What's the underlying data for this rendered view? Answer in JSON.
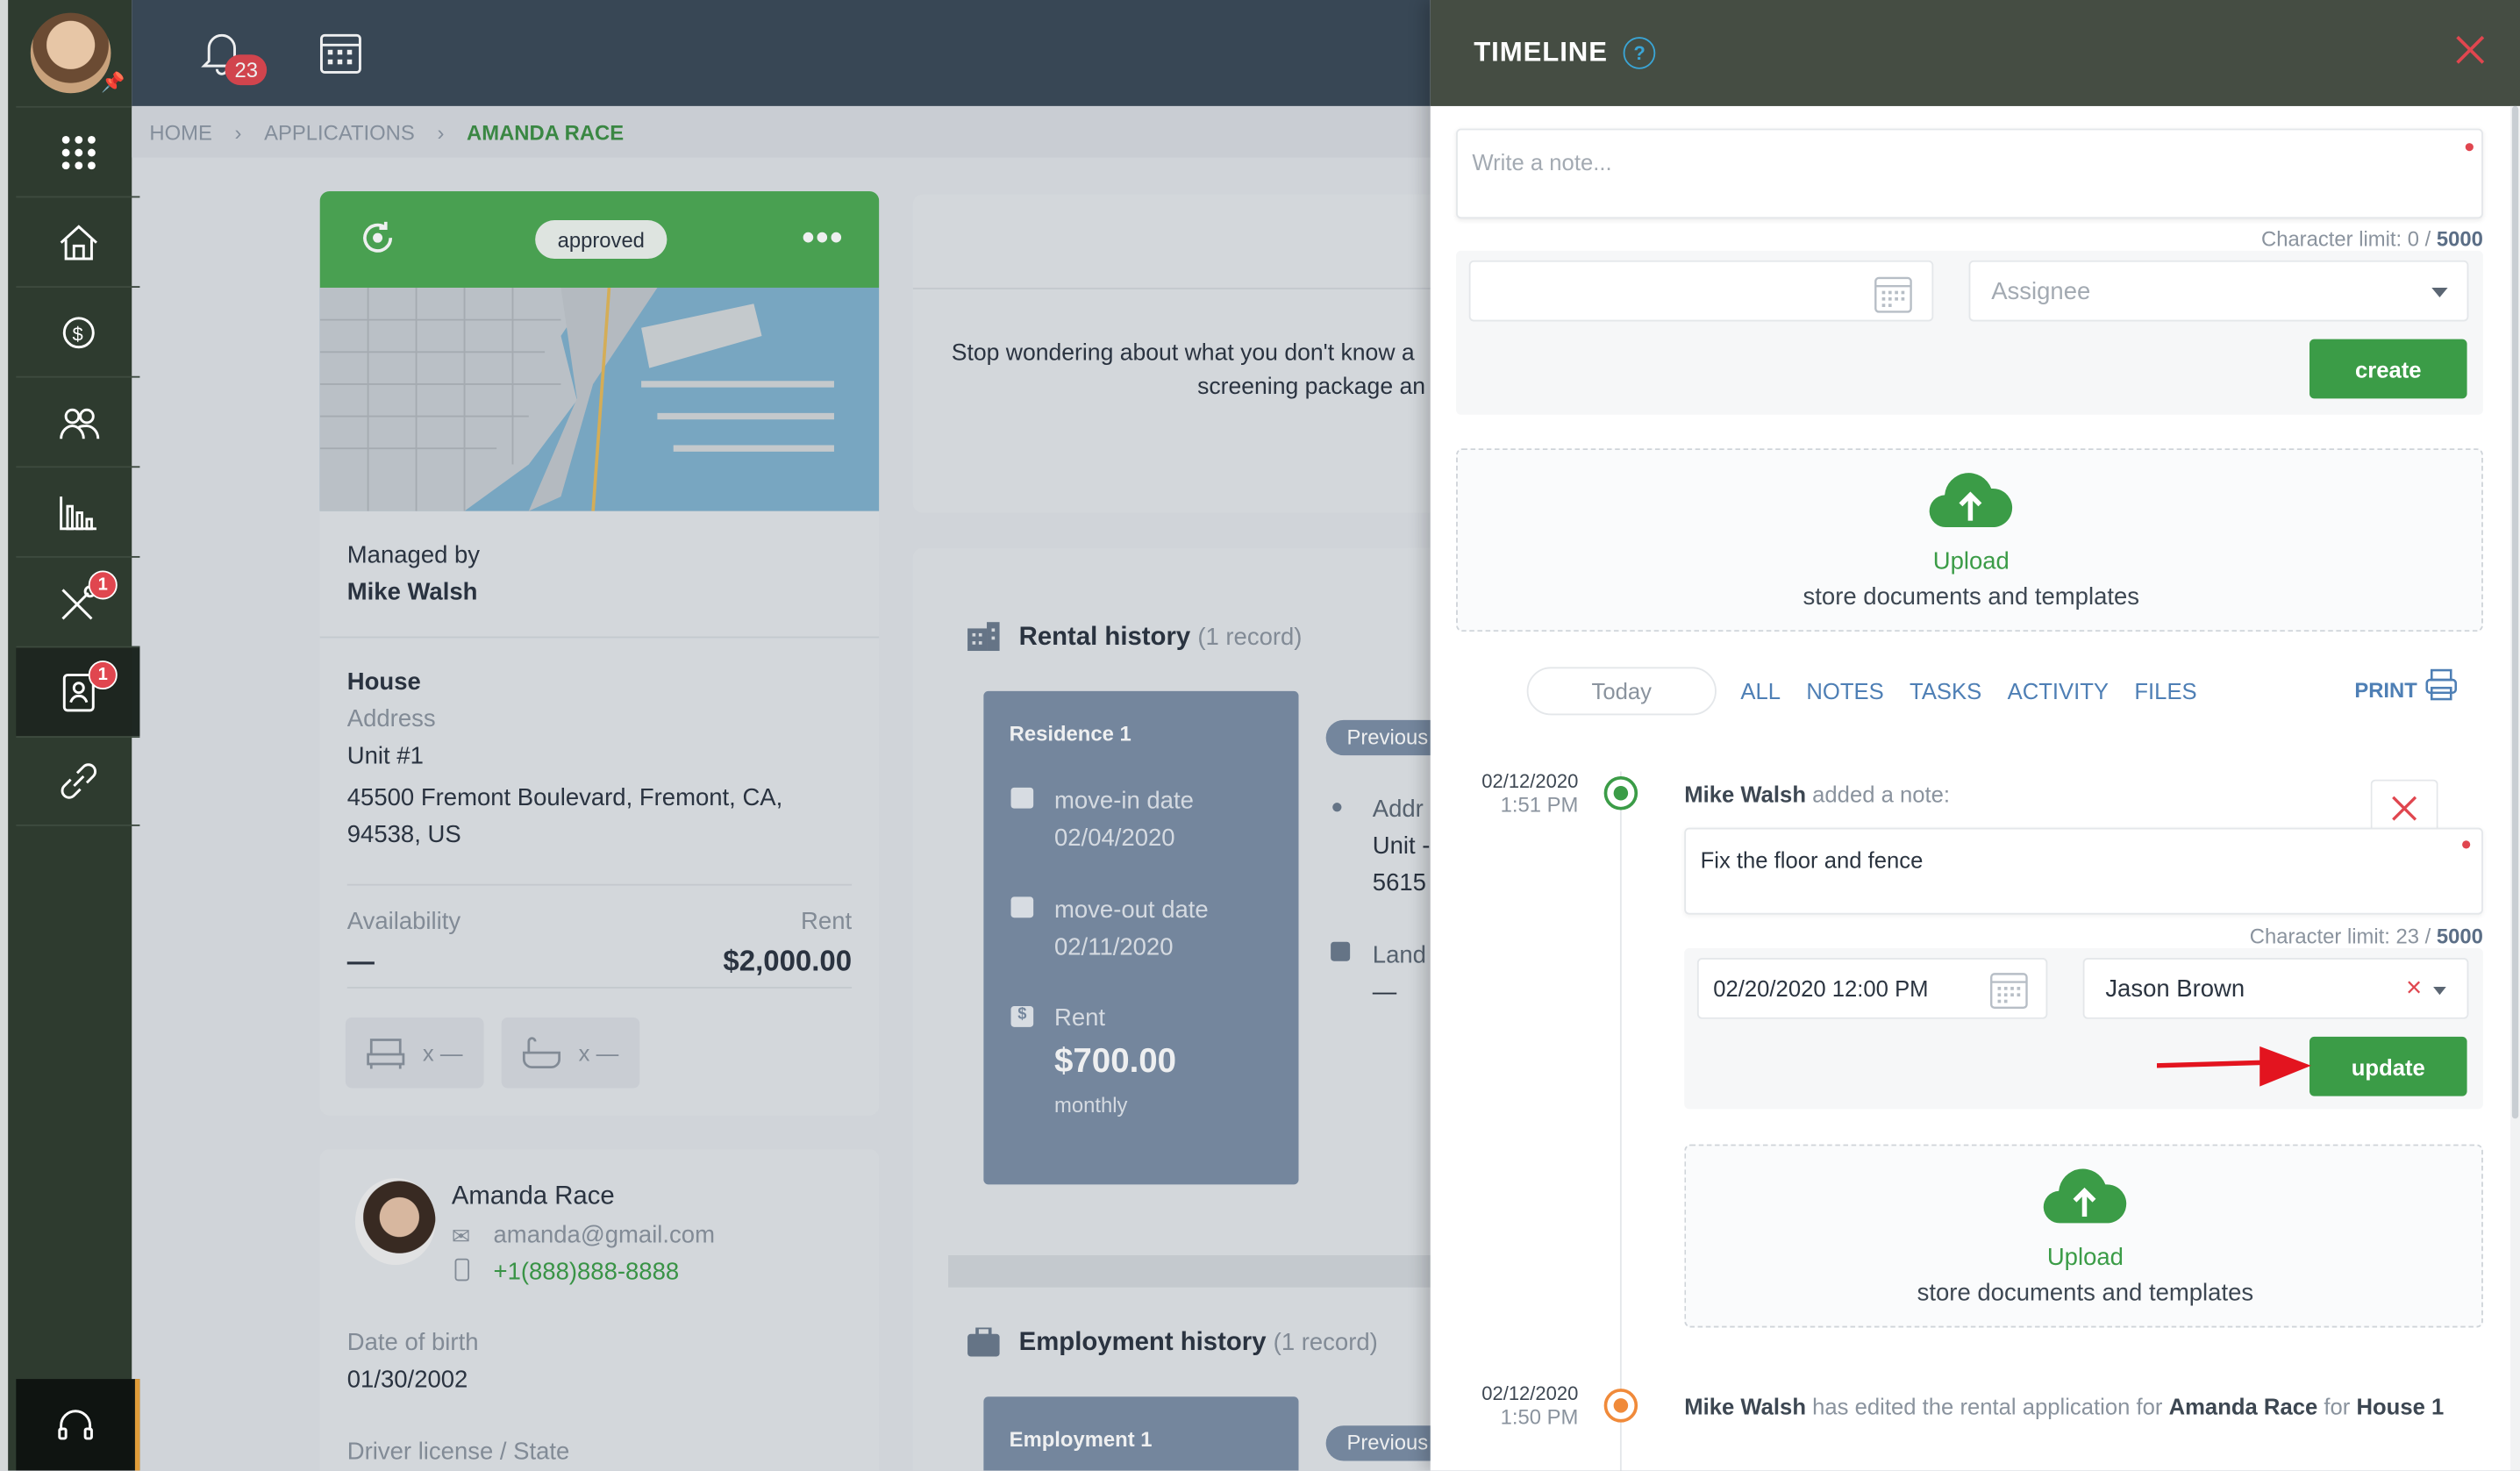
{
  "topbar": {
    "notification_count": "23"
  },
  "sidebar": {
    "badges": {
      "maintenance": "1",
      "applications": "1"
    }
  },
  "breadcrumb": {
    "home": "HOME",
    "applications": "APPLICATIONS",
    "current": "AMANDA RACE"
  },
  "property": {
    "status": "approved",
    "managed_by_label": "Managed by",
    "manager": "Mike Walsh",
    "type": "House",
    "address_label": "Address",
    "unit": "Unit #1",
    "address": "45500 Fremont Boulevard, Fremont, CA, 94538, US",
    "availability_label": "Availability",
    "availability_value": "—",
    "rent_label": "Rent",
    "rent_value": "$2,000.00",
    "beds": "x —",
    "baths": "x —"
  },
  "applicant": {
    "name": "Amanda Race",
    "email": "amanda@gmail.com",
    "phone": "+1(888)888-8888",
    "dob_label": "Date of birth",
    "dob": "01/30/2002",
    "license_label": "Driver license / State"
  },
  "screening": {
    "text_line1": "Stop wondering about what you don't know a",
    "text_line2": "screening package an"
  },
  "rental_history": {
    "title": "Rental history",
    "count": "(1 record)",
    "residence_title": "Residence 1",
    "movein_label": "move-in date",
    "movein": "02/04/2020",
    "moveout_label": "move-out date",
    "moveout": "02/11/2020",
    "rent_label": "Rent",
    "rent": "$700.00",
    "rent_period": "monthly",
    "previous_badge": "Previous",
    "addr_label": "Addr",
    "unit_partial": "Unit -",
    "num_partial": "5615",
    "land_label": "Land",
    "land_value": "—"
  },
  "employment_history": {
    "title": "Employment history",
    "count": "(1 record)",
    "item_title": "Employment 1",
    "previous_badge": "Previous"
  },
  "timeline": {
    "title": "TIMELINE",
    "help": "?",
    "note_placeholder": "Write a note...",
    "char_limit_label": "Character limit: 0 /",
    "char_max": "5000",
    "assignee_placeholder": "Assignee",
    "create_label": "create",
    "upload_label": "Upload",
    "upload_sub": "store documents and templates",
    "today_label": "Today",
    "tabs": [
      "ALL",
      "NOTES",
      "TASKS",
      "ACTIVITY",
      "FILES"
    ],
    "print_label": "PRINT",
    "entries": [
      {
        "date": "02/12/2020",
        "time": "1:51 PM",
        "author": "Mike Walsh",
        "action": "added a note:",
        "note": "Fix the floor and fence",
        "char_limit_label": "Character limit: 23 /",
        "char_max": "5000",
        "due": "02/20/2020 12:00 PM",
        "assignee": "Jason Brown",
        "update_label": "update",
        "upload_label": "Upload",
        "upload_sub": "store documents and templates"
      },
      {
        "date": "02/12/2020",
        "time": "1:50 PM",
        "author": "Mike Walsh",
        "action": "has edited the rental application for",
        "applicant": "Amanda Race",
        "for_word": "for",
        "property": "House 1"
      }
    ]
  },
  "colors": {
    "accent_green": "#3b9c47",
    "badge_red": "#e0464f",
    "panel_header": "#454d43"
  }
}
